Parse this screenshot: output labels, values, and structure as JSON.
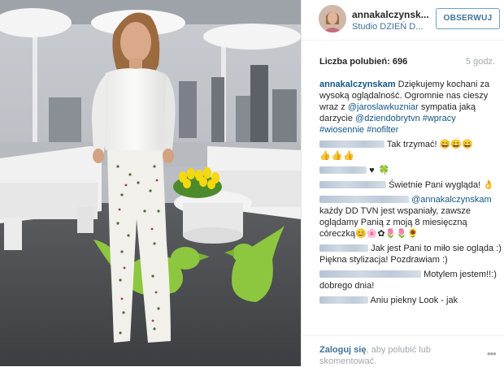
{
  "header": {
    "username": "annakalczynsk...",
    "location": "Studio DZIEŃ D...",
    "follow_label": "OBSERWUJ"
  },
  "stats": {
    "likes_label": "Liczba polubień: 696",
    "time_ago": "5 godz."
  },
  "caption": {
    "username": "annakalczynskam",
    "text1": "Dziękujemy kochani za wysoką oglądalność. Ogromnie nas cieszy wraz z ",
    "mention1": "@jaroslawkuzniar",
    "text2": " sympatia jaką darzycie ",
    "mention2": "@dziendobrytvn",
    "hashtag1": "#wpracy",
    "hashtag2": "#wiosennie",
    "hashtag3": "#nofilter"
  },
  "comments": [
    {
      "text": "Tak trzymać! 😄😄😄",
      "prefix": "👍👍👍"
    },
    {
      "text": "♥ 🍀"
    },
    {
      "text": "Świetnie Pani wygląda! 👌"
    },
    {
      "mention": "@annakalczynsk",
      "continuation": "am",
      "text": " każdy DD TVN jest wspaniały, zawsze oglądamy Panią z moją 8 miesięczną córeczką😊🌸✿🌷🌷🌻"
    },
    {
      "text": "Jak jest Pani to miło sie ogląda :) Piękna stylizacja! Pozdrawiam :)"
    },
    {
      "text": "Motylem jestem!!:) dobrego dnia!"
    },
    {
      "text": "Aniu piekny Look - jak"
    }
  ],
  "footer": {
    "login_link": "Zaloguj się",
    "login_rest": ", aby polubić lub skomentować.",
    "more_icon": "•••"
  },
  "colors": {
    "link_blue": "#3f729b",
    "username_blue": "#125688",
    "muted_gray": "#a5a7aa",
    "ottoman_green": "#8dc63f"
  },
  "icons": [
    "more-options-icon",
    "avatar"
  ]
}
